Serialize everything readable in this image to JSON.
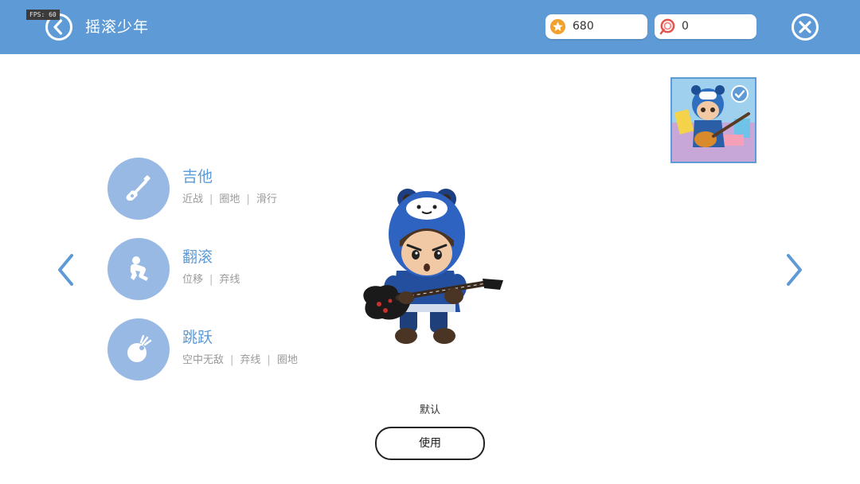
{
  "debug": {
    "fps": "FPS: 60"
  },
  "header": {
    "title": "摇滚少年",
    "back_icon": "chevron-left-circle-icon",
    "close_icon": "close-circle-icon",
    "color": "#5e9bd6"
  },
  "currency": {
    "coins": {
      "icon": "star-coin-icon",
      "value": "680",
      "color": "#f2a12c"
    },
    "lollipops": {
      "icon": "lollipop-icon",
      "value": "0",
      "color": "#e2554f"
    }
  },
  "skills": [
    {
      "icon": "guitar-icon",
      "name": "吉他",
      "tags": [
        "近战",
        "圈地",
        "滑行"
      ]
    },
    {
      "icon": "roll-icon",
      "name": "翻滚",
      "tags": [
        "位移",
        "弃线"
      ]
    },
    {
      "icon": "jump-icon",
      "name": "跳跃",
      "tags": [
        "空中无敌",
        "弃线",
        "圈地"
      ]
    }
  ],
  "navigation": {
    "prev_icon": "chevron-left-icon",
    "next_icon": "chevron-right-icon"
  },
  "skin": {
    "name": "默认",
    "use_label": "使用",
    "thumbnail_icon": "character-thumbnail-icon",
    "selected_icon": "check-icon",
    "character_icon": "rock-boy-character-icon"
  }
}
